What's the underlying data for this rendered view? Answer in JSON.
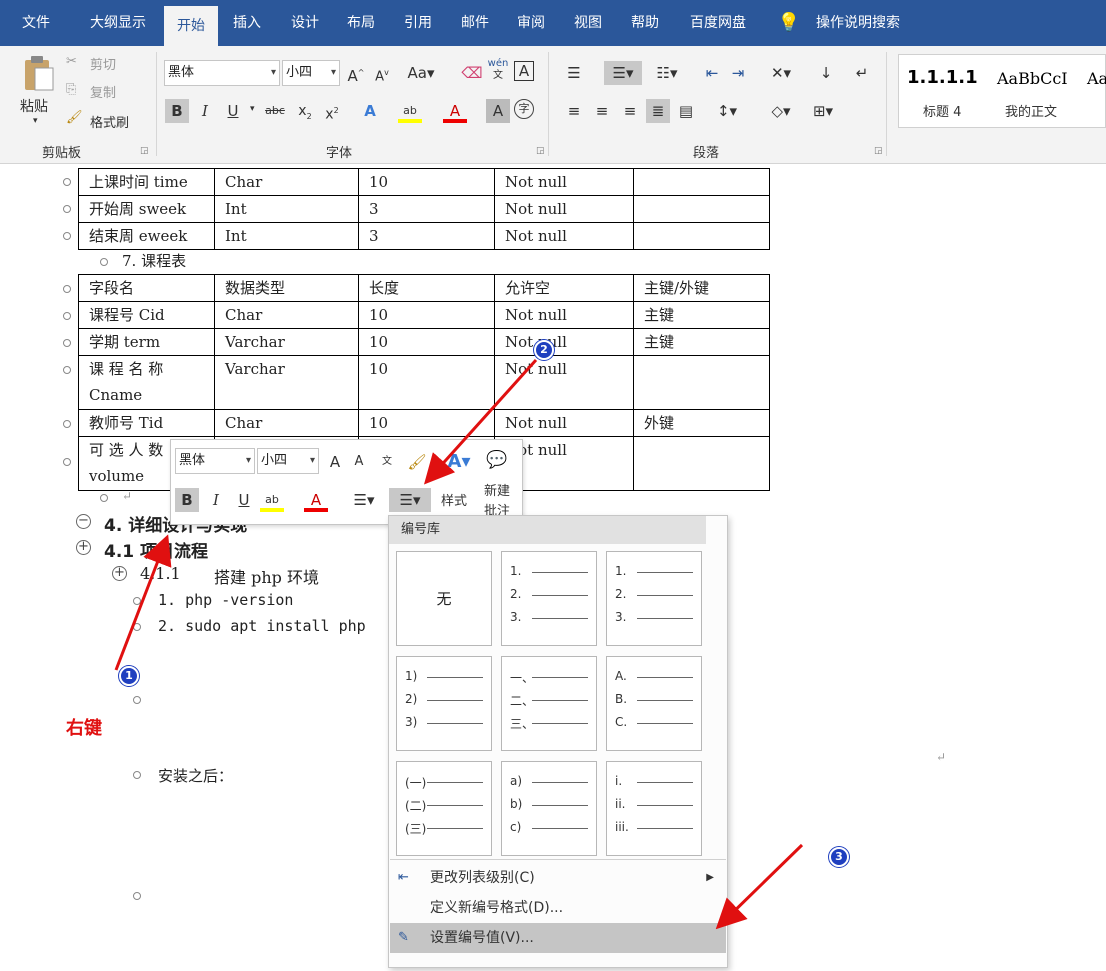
{
  "tabs": [
    "文件",
    "大纲显示",
    "开始",
    "插入",
    "设计",
    "布局",
    "引用",
    "邮件",
    "审阅",
    "视图",
    "帮助",
    "百度网盘"
  ],
  "tell_me": "操作说明搜索",
  "clipboard": {
    "paste": "粘贴",
    "cut": "剪切",
    "copy": "复制",
    "format_painter": "格式刷",
    "group": "剪贴板"
  },
  "font": {
    "name": "黑体",
    "size": "小四",
    "group": "字体",
    "case_label": "Aa",
    "phonetic": "wén"
  },
  "paragraph": {
    "group": "段落"
  },
  "styles": [
    {
      "preview": "1.1.1.1",
      "name": "标题 4"
    },
    {
      "preview": "AaBbCcI",
      "name": "我的正文"
    },
    {
      "preview": "Aa",
      "name": ""
    }
  ],
  "table1": {
    "rows": [
      [
        "上课时间 time",
        "Char",
        "10",
        "Not null",
        ""
      ],
      [
        "开始周 sweek",
        "Int",
        "3",
        "Not null",
        ""
      ],
      [
        "结束周 eweek",
        "Int",
        "3",
        "Not null",
        ""
      ]
    ]
  },
  "course_heading": "7. 课程表",
  "table2": {
    "rows": [
      [
        "字段名",
        "数据类型",
        "长度",
        "允许空 ",
        "主键/外键 "
      ],
      [
        "课程号 Cid",
        "Char",
        "10",
        "Not null",
        "主键"
      ],
      [
        "学期 term",
        "Varchar",
        "10",
        "Not null",
        "主键"
      ],
      [
        "课 程 名 称 Cname",
        "Varchar",
        "10",
        "Not null",
        ""
      ],
      [
        "教师号 Tid",
        "Char",
        "10",
        "Not null",
        "外键"
      ],
      [
        "可 选 人 数 volume",
        "",
        "",
        "Not null",
        ""
      ]
    ]
  },
  "section4": "4. 详细设计与实现",
  "section41": "4.1  项目流程",
  "section411_num": "4.1.1",
  "section411_title": "搭建 php 环境",
  "list1": "1. php  -version",
  "list2": "2. sudo  apt  install  php",
  "after_install": "安装之后：",
  "mini": {
    "font": "黑体",
    "size": "小四",
    "styles": "样式",
    "new_comment_1": "新建",
    "new_comment_2": "批注"
  },
  "gallery": {
    "title": "编号库",
    "none": "无",
    "cells": [
      [
        "1.",
        "2.",
        "3."
      ],
      [
        "1.",
        "2.",
        "3."
      ],
      [
        "1)",
        "2)",
        "3)"
      ],
      [
        "一、",
        "二、",
        "三、"
      ],
      [
        "A.",
        "B.",
        "C."
      ],
      [
        "(一)",
        "(二)",
        "(三)"
      ],
      [
        "a)",
        "b)",
        "c)"
      ],
      [
        "i.",
        "ii.",
        "iii."
      ]
    ],
    "menu": [
      "更改列表级别(C)",
      "定义新编号格式(D)...",
      "设置编号值(V)..."
    ]
  },
  "annotations": {
    "right_click": "右键",
    "step1": "1",
    "step2": "2",
    "step3": "3"
  },
  "colors": {
    "ribbon_blue": "#2b579a",
    "arrow_red": "#e01010",
    "badge_blue": "#1f3fbf"
  }
}
